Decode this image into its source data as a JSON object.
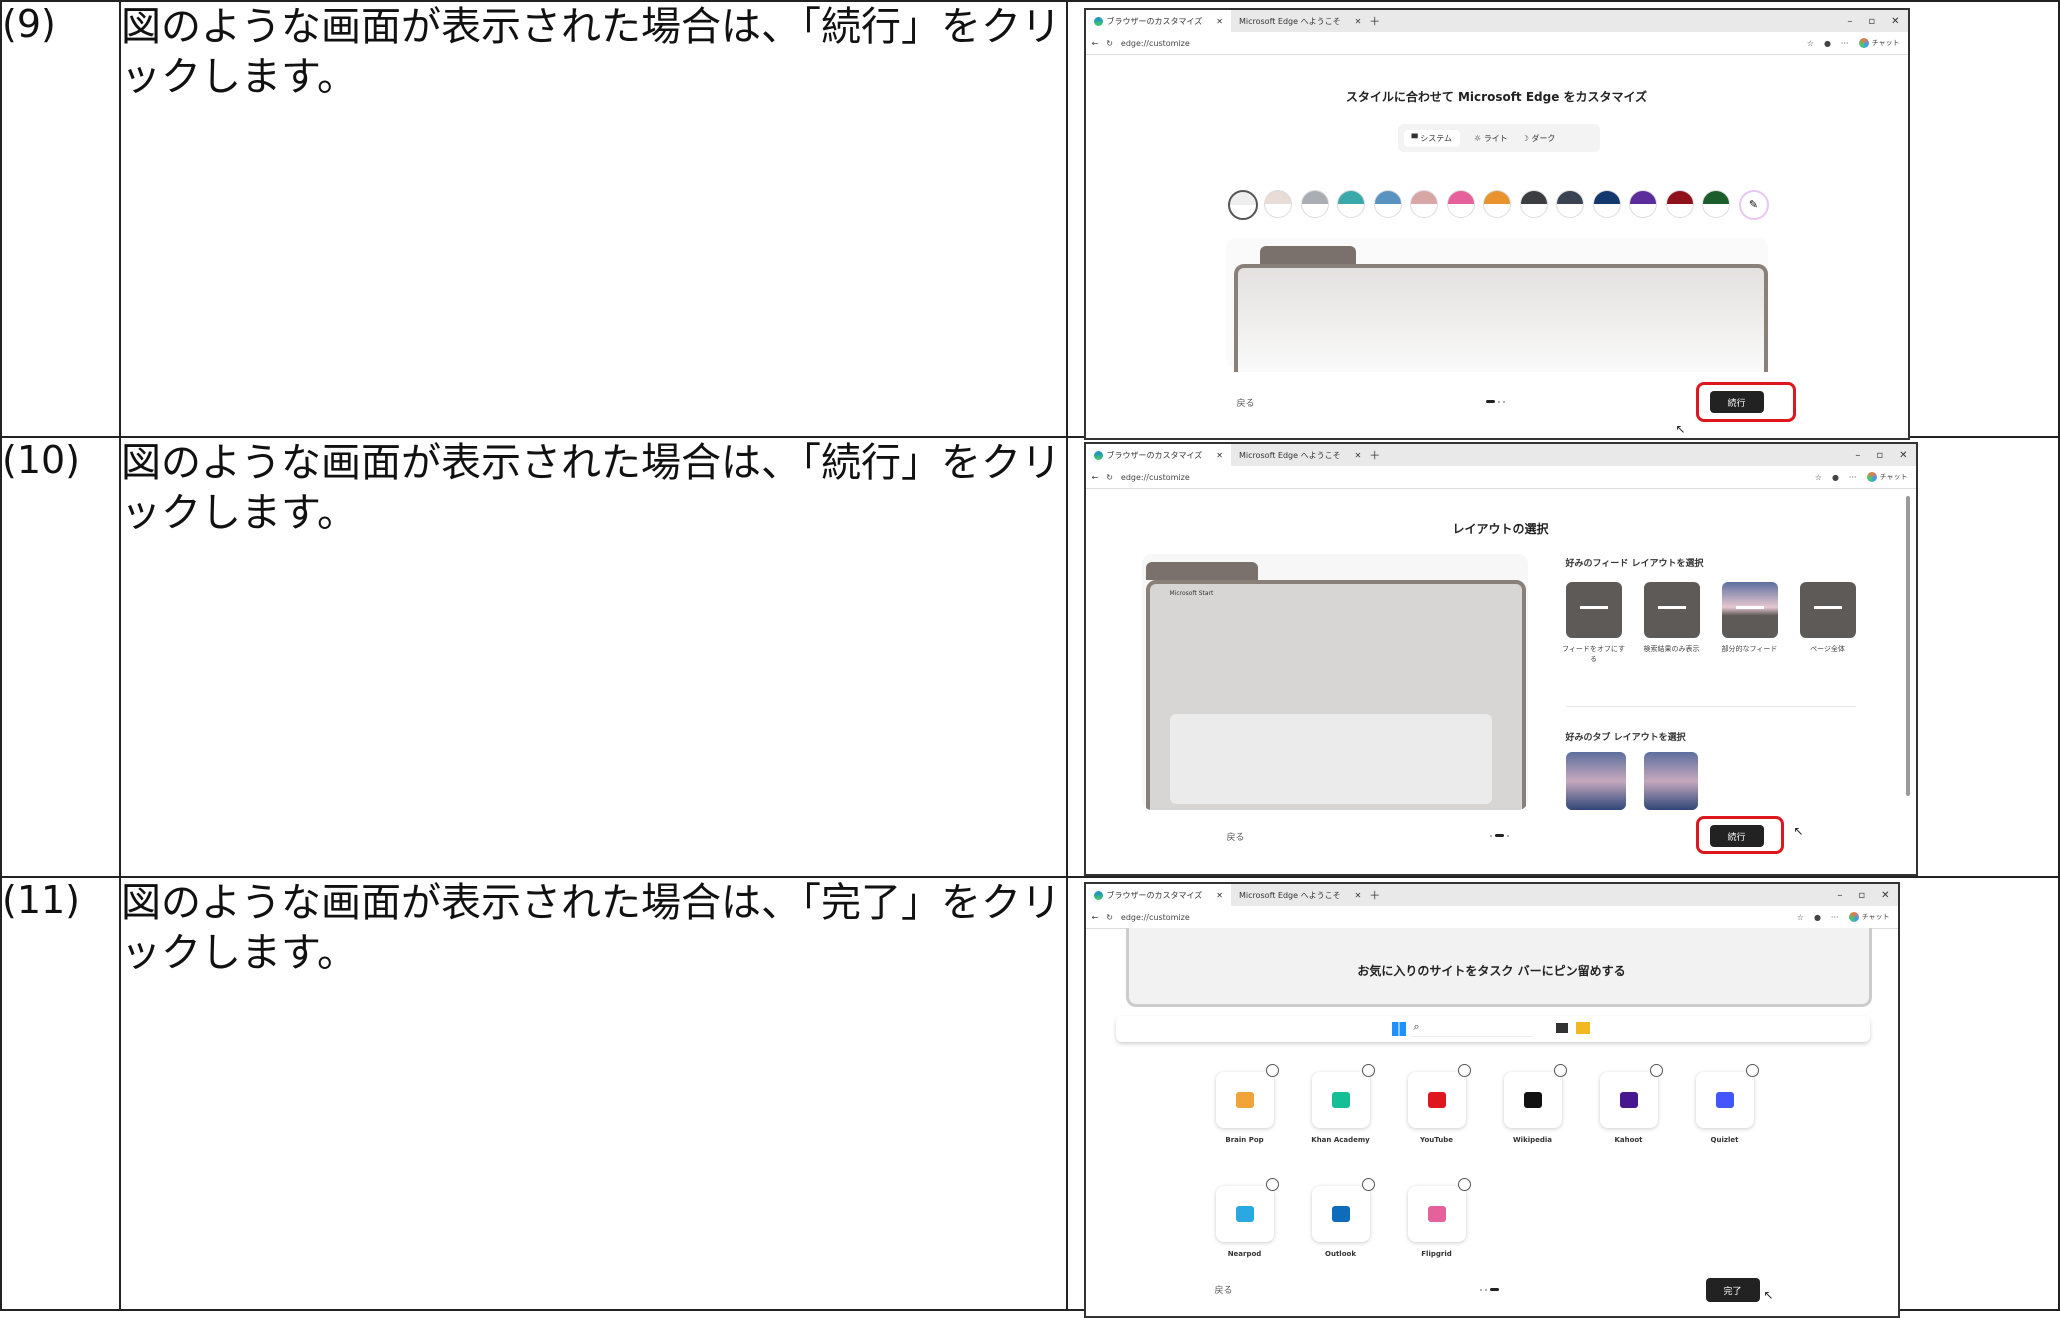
{
  "rows": [
    {
      "number": "(9)",
      "instruction": "図のような画面が表示された場合は、「続行」をクリックします。",
      "browser": {
        "tab1": "ブラウザーのカスタマイズ",
        "tab2": "Microsoft Edge へようこそ",
        "url": "edge://customize",
        "chat": "チャット",
        "heading": "スタイルに合わせて Microsoft Edge をカスタマイズ",
        "modes": [
          "システム",
          "ライト",
          "ダーク"
        ],
        "swatches": [
          "#eeeeee",
          "#e8ddd6",
          "#a9aeb4",
          "#3aa9aa",
          "#5b93c0",
          "#d9a6a6",
          "#e6609b",
          "#e8932d",
          "#3b3d40",
          "#3b4352",
          "#12386e",
          "#5c2b9c",
          "#8e111c",
          "#1b5e2c"
        ],
        "back": "戻る",
        "continue": "続行"
      }
    },
    {
      "number": "(10)",
      "instruction": "図のような画面が表示された場合は、「続行」をクリックします。",
      "browser": {
        "tab1": "ブラウザーのカスタマイズ",
        "tab2": "Microsoft Edge へようこそ",
        "url": "edge://customize",
        "chat": "チャット",
        "heading": "レイアウトの選択",
        "mini_brand": "Microsoft Start",
        "feed_heading": "好みのフィード レイアウトを選択",
        "feed_options": [
          "フィードをオフにする",
          "検索結果のみ表示",
          "部分的なフィード",
          "ページ全体"
        ],
        "tab_heading": "好みのタブ レイアウトを選択",
        "back": "戻る",
        "continue": "続行"
      }
    },
    {
      "number": "(11)",
      "instruction": "図のような画面が表示された場合は、「完了」をクリックします。",
      "browser": {
        "tab1": "ブラウザーのカスタマイズ",
        "tab2": "Microsoft Edge へようこそ",
        "url": "edge://customize",
        "chat": "チャット",
        "heading": "お気に入りのサイトをタスク バーにピン留めする",
        "sites": [
          {
            "name": "Brain Pop",
            "icon": "brainpop-icon",
            "color": "#f2a33a"
          },
          {
            "name": "Khan Academy",
            "icon": "khan-academy-icon",
            "color": "#14bf96"
          },
          {
            "name": "YouTube",
            "icon": "youtube-icon",
            "color": "#e0161e"
          },
          {
            "name": "Wikipedia",
            "icon": "wikipedia-icon",
            "color": "#111111"
          },
          {
            "name": "Kahoot",
            "icon": "kahoot-icon",
            "color": "#46178f"
          },
          {
            "name": "Quizlet",
            "icon": "quizlet-icon",
            "color": "#4255ff"
          },
          {
            "name": "Nearpod",
            "icon": "nearpod-icon",
            "color": "#2aa9e0"
          },
          {
            "name": "Outlook",
            "icon": "outlook-icon",
            "color": "#0f6cbd"
          },
          {
            "name": "Flipgrid",
            "icon": "flipgrid-icon",
            "color": "#e6609b"
          }
        ],
        "back": "戻る",
        "done": "完了"
      }
    }
  ]
}
